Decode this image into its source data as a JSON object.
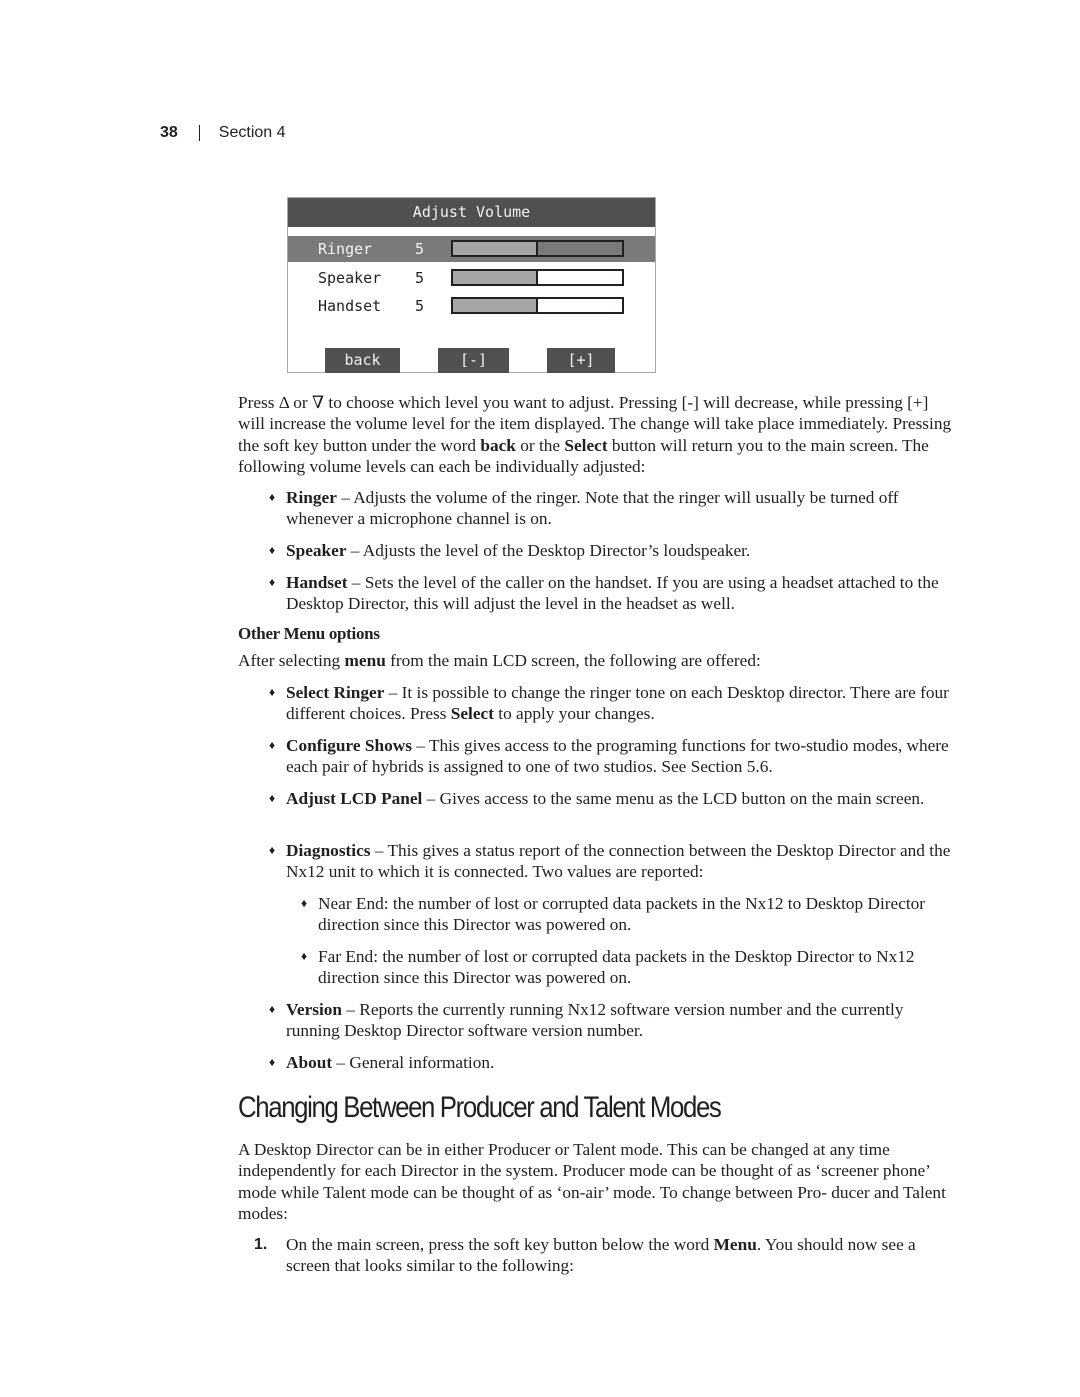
{
  "header": {
    "page_number": "38",
    "section": "Section 4"
  },
  "lcd": {
    "title": "Adjust Volume",
    "rows": [
      {
        "name": "Ringer",
        "value": "5",
        "level_fraction": 0.5,
        "selected": true
      },
      {
        "name": "Speaker",
        "value": "5",
        "level_fraction": 0.5,
        "selected": false
      },
      {
        "name": "Handset",
        "value": "5",
        "level_fraction": 0.5,
        "selected": false
      }
    ],
    "softkeys": [
      "back",
      "[-]",
      "[+]"
    ]
  },
  "intro": {
    "p1_a": "Press Δ or ∇ to choose which level you want to adjust. Pressing [-] will decrease, while pressing [+] will increase the volume level for the item displayed. The change will take place immediately. Pressing the soft key button under the word ",
    "p1_b1": "back",
    "p1_c": " or the ",
    "p1_b2": "Select",
    "p1_d": " button will return you to the main screen. The following volume levels can each be individually adjusted:"
  },
  "volume_items": [
    {
      "term": "Ringer",
      "desc": " – Adjusts the volume of the ringer. Note that the ringer will usually be turned off whenever a microphone channel is on."
    },
    {
      "term": "Speaker",
      "desc": " – Adjusts the level of the Desktop Director’s loudspeaker."
    },
    {
      "term": "Handset",
      "desc": " – Sets the level of the caller on the handset. If you are using a headset attached to the Desktop Director, this will adjust the level in the headset as well."
    }
  ],
  "other_menu": {
    "heading": "Other Menu options",
    "intro_a": "After selecting ",
    "intro_b": "menu",
    "intro_c": " from the main LCD screen, the following are offered:",
    "items": [
      {
        "term": "Select Ringer",
        "desc_a": " – It is possible to change the ringer tone on each Desktop director. There are four different choices. Press ",
        "desc_b": "Select",
        "desc_c": " to apply your changes."
      },
      {
        "term": "Configure Shows",
        "desc_a": " – This gives access to the programing functions for two-studio modes, where each pair of hybrids is assigned to one of two studios. See Section 5.6."
      },
      {
        "term": "Adjust LCD Panel",
        "desc_a": " – Gives access to the same menu as the LCD button on the main screen."
      },
      {
        "term": "Diagnostics",
        "desc_a": " – This gives a status report of the connection between the Desktop Director and the Nx12 unit to which it is connected. Two values are reported:"
      },
      {
        "term": "Version",
        "desc_a": " – Reports the currently running Nx12 software version number and the currently running Desktop Director software version number."
      },
      {
        "term": "About",
        "desc_a": " – General information."
      }
    ],
    "diagnostics_sub": [
      "Near End: the number of lost or corrupted data packets in the Nx12 to Desktop Director direction since this Director was powered on.",
      "Far End: the number of lost or corrupted data packets in the Desktop Director to Nx12 direction since this Director was powered on."
    ]
  },
  "modes_section": {
    "heading": "Changing Between Producer and Talent Modes",
    "paragraph": "A Desktop Director can be in either Producer or Talent mode. This can be changed at any time independently for each Director in the system. Producer mode can be thought of as ‘screener phone’ mode while Talent mode can be thought of as ‘on-air’ mode. To change between Pro- ducer and Talent modes:",
    "steps": [
      {
        "number": "1.",
        "text_a": "On the main screen, press the soft key button below the word ",
        "text_b": "Menu",
        "text_c": ". You should now see a screen that looks similar to the following:"
      }
    ]
  },
  "icons": {
    "bullet": "♦"
  }
}
